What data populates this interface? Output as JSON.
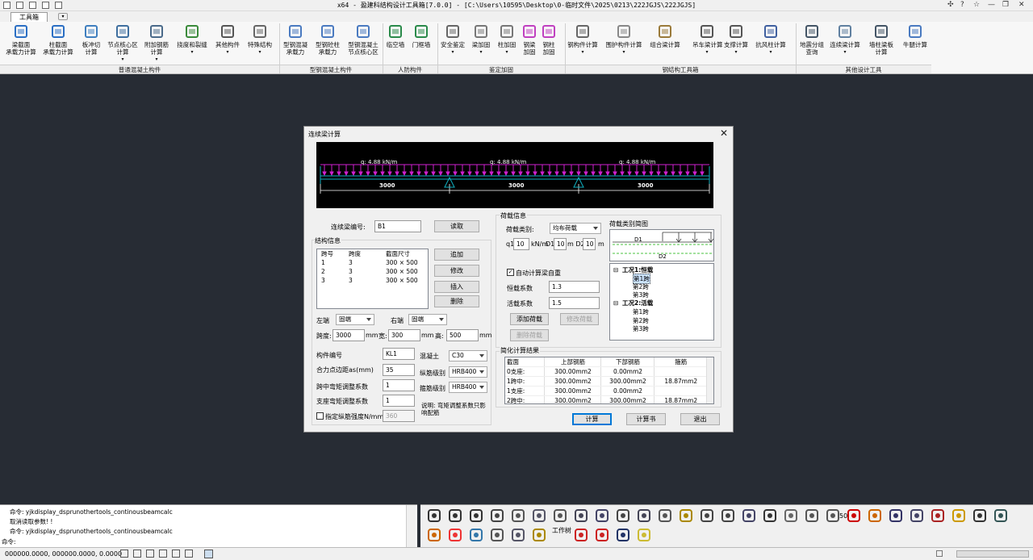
{
  "window": {
    "title": "x64 - 盈建科结构设计工具箱[7.0.0] - [C:\\Users\\10595\\Desktop\\0-临时文件\\2025\\0213\\222JGJS\\222JGJS]"
  },
  "tabs": {
    "active": "工具箱"
  },
  "ribbon": {
    "buttons": [
      {
        "l1": "梁截面",
        "l2": "承载力计算"
      },
      {
        "l1": "柱截面",
        "l2": "承载力计算"
      },
      {
        "l1": "板冲切",
        "l2": "计算"
      },
      {
        "l1": "节点核心区",
        "l2": "计算"
      },
      {
        "l1": "附加钢筋",
        "l2": "计算"
      },
      {
        "l1": "挠度和裂缝",
        "l2": ""
      },
      {
        "l1": "其他构件",
        "l2": ""
      },
      {
        "l1": "特殊结构",
        "l2": ""
      },
      {
        "l1": "型钢混凝",
        "l2": "承载力"
      },
      {
        "l1": "型钢砼柱",
        "l2": "承载力"
      },
      {
        "l1": "型钢混凝土",
        "l2": "节点核心区"
      },
      {
        "l1": "临空墙",
        "l2": ""
      },
      {
        "l1": "门框墙",
        "l2": ""
      },
      {
        "l1": "安全鉴定",
        "l2": ""
      },
      {
        "l1": "梁加固",
        "l2": ""
      },
      {
        "l1": "柱加固",
        "l2": ""
      },
      {
        "l1": "钢梁",
        "l2": "加固"
      },
      {
        "l1": "钢柱",
        "l2": "加固"
      },
      {
        "l1": "钢构件计算",
        "l2": ""
      },
      {
        "l1": "围护构件计算",
        "l2": ""
      },
      {
        "l1": "组合梁计算",
        "l2": ""
      },
      {
        "l1": "吊车梁计算",
        "l2": ""
      },
      {
        "l1": "支撑计算",
        "l2": ""
      },
      {
        "l1": "抗风柱计算",
        "l2": ""
      },
      {
        "l1": "地震分组",
        "l2": "查询"
      },
      {
        "l1": "连续梁计算",
        "l2": ""
      },
      {
        "l1": "墙柱梁板",
        "l2": "计算"
      },
      {
        "l1": "牛腿计算",
        "l2": ""
      }
    ],
    "groups": [
      "普通混凝土构件",
      "型钢混凝土构件",
      "人防构件",
      "鉴定加固",
      "钢结构工具箱",
      "其他设计工具"
    ]
  },
  "dialog": {
    "title": "连续梁计算",
    "diagram": {
      "load_label": "q: 4.88 kN/m",
      "spans": [
        "3000",
        "3000",
        "3000"
      ]
    },
    "beam_no_label": "连续梁编号:",
    "beam_no": "B1",
    "read_btn": "读取",
    "struct_title": "结构信息",
    "struct_headers": [
      "跨号",
      "跨度",
      "截面尺寸"
    ],
    "struct_rows": [
      [
        "1",
        "3",
        "300 × 500"
      ],
      [
        "2",
        "3",
        "300 × 500"
      ],
      [
        "3",
        "3",
        "300 × 500"
      ]
    ],
    "add_btn": "追加",
    "modify_btn": "修改",
    "insert_btn": "插入",
    "delete_btn": "删除",
    "left_end_label": "左端",
    "left_end": "固端",
    "right_end_label": "右端",
    "right_end": "固端",
    "span_label": "跨度:",
    "span": "3000",
    "width_label": "宽:",
    "width": "300",
    "height_label": "高:",
    "height": "500",
    "unit_mm": "mm",
    "member_no_label": "构件编号",
    "member_no": "KL1",
    "concrete_label": "混凝土",
    "concrete": "C30",
    "as_label": "合力点边距as(mm)",
    "as": "35",
    "long_bar_label": "纵筋级别",
    "long_bar": "HRB400",
    "mid_coef_label": "跨中弯矩调整系数",
    "mid_coef": "1",
    "stirrup_label": "箍筋级别",
    "stirrup": "HRB400",
    "sup_coef_label": "支座弯矩调整系数",
    "sup_coef": "1",
    "note": "说明: 弯矩调整系数只影响配筋",
    "fy_label": "指定纵筋强度N/mm2",
    "fy": "360",
    "load_title": "荷载信息",
    "load_type_label": "荷载类别:",
    "load_type": "均布荷载",
    "q1_label": "q1",
    "q1": "10",
    "q1_unit": "kN/m",
    "d1_label": "D1",
    "d1": "10",
    "d2_label": "m D2",
    "d2": "10",
    "d2_unit": "m",
    "self_weight_label": "自动计算梁自重",
    "dead_coef_label": "恒载系数",
    "dead_coef": "1.3",
    "live_coef_label": "活载系数",
    "live_coef": "1.5",
    "add_load_btn": "添加荷载",
    "modify_load_btn": "修改荷载",
    "delete_load_btn": "删除荷载",
    "load_schema_title": "荷载类别简图",
    "schema_d1": "D1",
    "schema_d2": "D2",
    "tree": {
      "case1": "工况1:恒载",
      "case1_items": [
        "第1跨",
        "第2跨",
        "第3跨"
      ],
      "case2": "工况2:活载",
      "case2_items": [
        "第1跨",
        "第2跨",
        "第3跨"
      ]
    },
    "result_title": "简化计算结果",
    "result_headers": [
      "截面",
      "上部钢筋",
      "下部钢筋",
      "箍筋"
    ],
    "result_rows": [
      [
        "0支座:",
        "300.00mm2",
        "0.00mm2",
        ""
      ],
      [
        "1跨中:",
        "300.00mm2",
        "300.00mm2",
        "18.87mm2"
      ],
      [
        "1支座:",
        "300.00mm2",
        "0.00mm2",
        ""
      ],
      [
        "2跨中:",
        "300.00mm2",
        "300.00mm2",
        "18.87mm2"
      ]
    ],
    "calc_btn": "计算",
    "report_btn": "计算书",
    "exit_btn": "退出"
  },
  "command": {
    "lines": [
      "命令: yjkdisplay_dsprunothertools_continousbeamcalc",
      "取消读取参数! !",
      "命令: yjkdisplay_dsprunothertools_continousbeamcalc",
      "命令:"
    ],
    "toolbar_labels": {
      "work_tree": "工作树",
      "size_50": "50"
    }
  },
  "status": {
    "coords": "000000.0000, 000000.0000, 0.0000"
  }
}
